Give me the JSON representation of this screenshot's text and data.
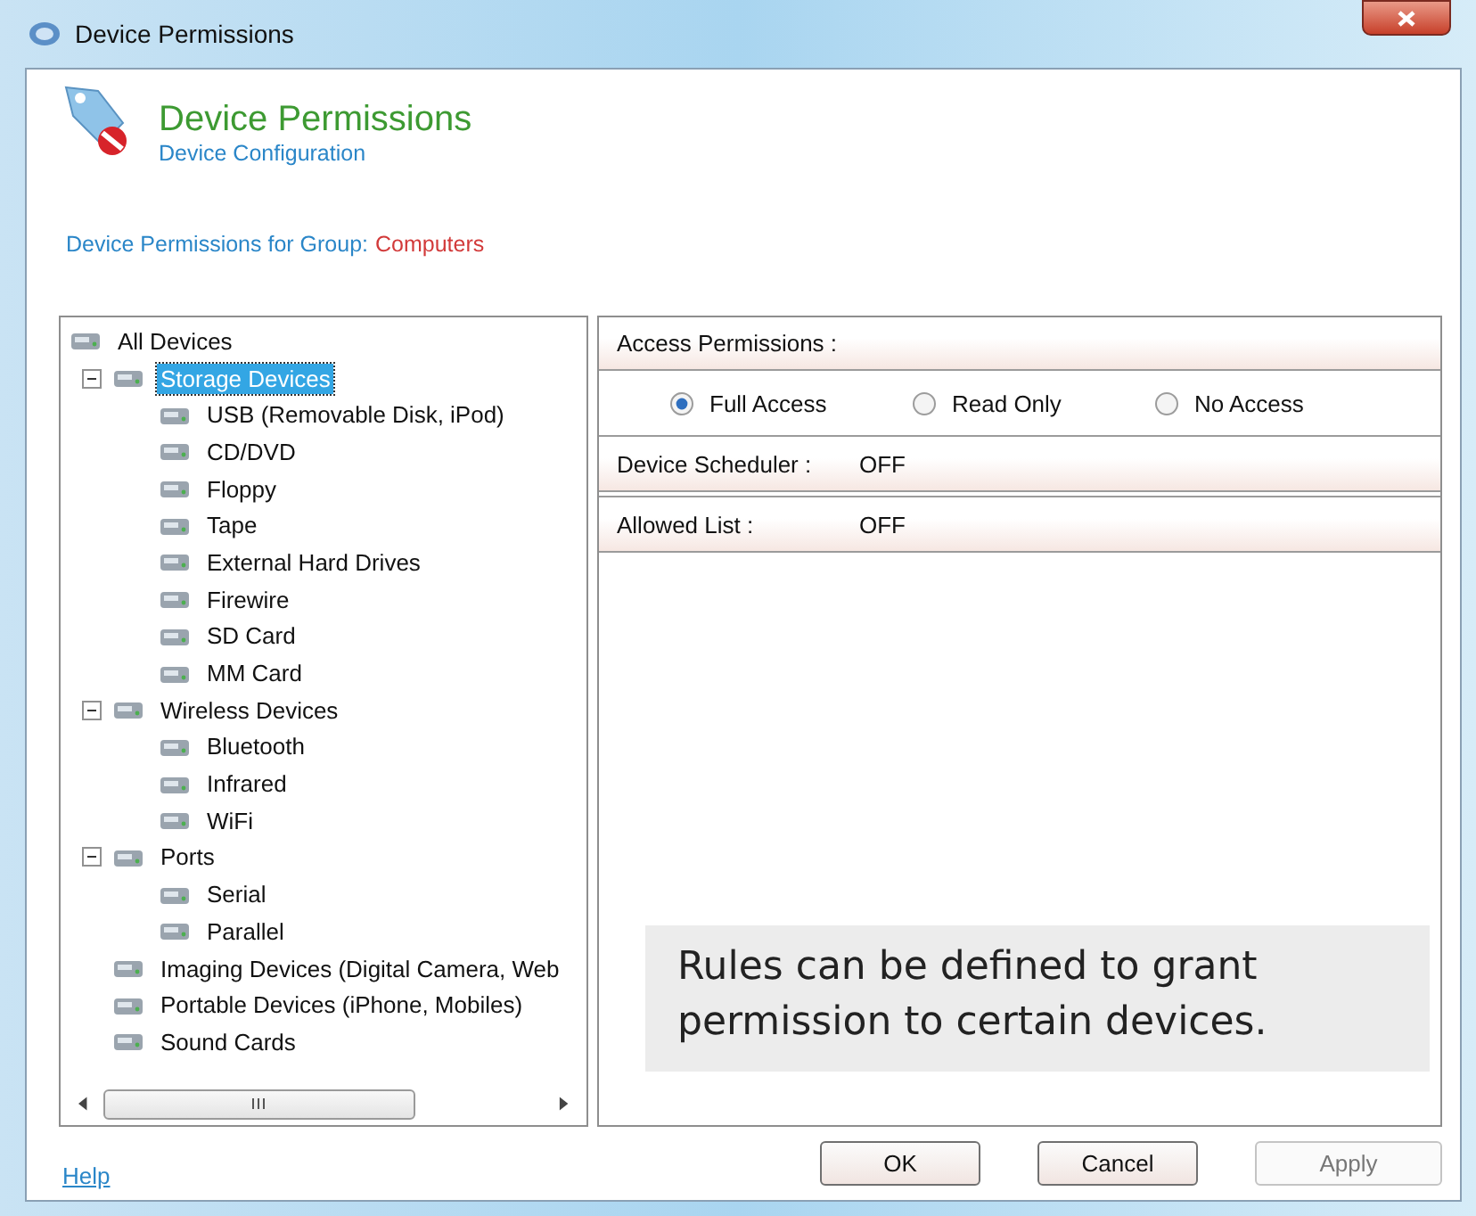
{
  "window": {
    "title": "Device Permissions"
  },
  "header": {
    "title": "Device Permissions",
    "subtitle": "Device Configuration"
  },
  "group_line": {
    "label": "Device Permissions for Group:",
    "group": "Computers"
  },
  "tree": {
    "label": "All Devices",
    "selected": false,
    "children": [
      {
        "label": "Storage Devices",
        "selected": true,
        "expanded": true,
        "children": [
          {
            "label": "USB (Removable Disk, iPod)",
            "selected": false
          },
          {
            "label": "CD/DVD",
            "selected": false
          },
          {
            "label": "Floppy",
            "selected": false
          },
          {
            "label": "Tape",
            "selected": false
          },
          {
            "label": "External Hard Drives",
            "selected": false
          },
          {
            "label": "Firewire",
            "selected": false
          },
          {
            "label": "SD Card",
            "selected": false
          },
          {
            "label": "MM Card",
            "selected": false
          }
        ]
      },
      {
        "label": "Wireless Devices",
        "selected": false,
        "expanded": true,
        "children": [
          {
            "label": "Bluetooth",
            "selected": false
          },
          {
            "label": "Infrared",
            "selected": false
          },
          {
            "label": "WiFi",
            "selected": false
          }
        ]
      },
      {
        "label": "Ports",
        "selected": false,
        "expanded": true,
        "children": [
          {
            "label": "Serial",
            "selected": false
          },
          {
            "label": "Parallel",
            "selected": false
          }
        ]
      },
      {
        "label": "Imaging Devices (Digital Camera, Web",
        "selected": false
      },
      {
        "label": "Portable Devices (iPhone, Mobiles)",
        "selected": false
      },
      {
        "label": "Sound Cards",
        "selected": false
      }
    ]
  },
  "access": {
    "label": "Access Permissions :",
    "options": [
      {
        "label": "Full Access",
        "selected": true
      },
      {
        "label": "Read Only",
        "selected": false
      },
      {
        "label": "No Access",
        "selected": false
      }
    ]
  },
  "settings": [
    {
      "label": "Device Scheduler :",
      "value": "OFF"
    },
    {
      "label": "Allowed List :",
      "value": "OFF"
    }
  ],
  "callout": "Rules can be defined to grant permission to certain devices.",
  "help_link": "Help",
  "buttons": [
    {
      "label": "OK",
      "disabled": false
    },
    {
      "label": "Cancel",
      "disabled": false
    },
    {
      "label": "Apply",
      "disabled": true
    }
  ]
}
